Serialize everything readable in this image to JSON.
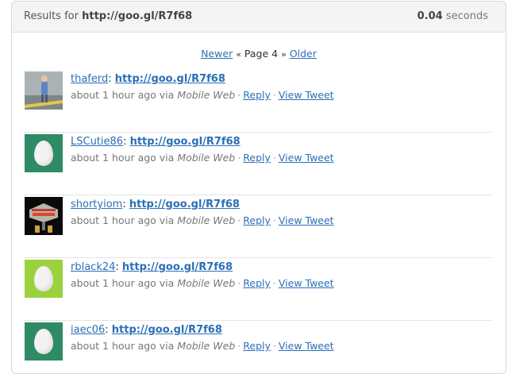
{
  "header": {
    "results_prefix": "Results for",
    "query": "http://goo.gl/R7f68",
    "time_value": "0.04",
    "time_unit": "seconds"
  },
  "pager": {
    "newer_label": "Newer",
    "page_label": "Page 4",
    "older_label": "Older",
    "left_sep": "«",
    "right_sep": "»"
  },
  "tweets": [
    {
      "user": "thaferd",
      "url": "http://goo.gl/R7f68",
      "time": "about 1 hour ago via",
      "source": "Mobile Web",
      "reply": "Reply",
      "view": "View Tweet",
      "avatar": "photo-avatar"
    },
    {
      "user": "LSCutie86",
      "url": "http://goo.gl/R7f68",
      "time": "about 1 hour ago via",
      "source": "Mobile Web",
      "reply": "Reply",
      "view": "View Tweet",
      "avatar": "egg-avatar"
    },
    {
      "user": "shortyiom",
      "url": "http://goo.gl/R7f68",
      "time": "about 1 hour ago via",
      "source": "Mobile Web",
      "reply": "Reply",
      "view": "View Tweet",
      "avatar": "las-vegas-avatar"
    },
    {
      "user": "rblack24",
      "url": "http://goo.gl/R7f68",
      "time": "about 1 hour ago via",
      "source": "Mobile Web",
      "reply": "Reply",
      "view": "View Tweet",
      "avatar": "egg-avatar"
    },
    {
      "user": "iaec06",
      "url": "http://goo.gl/R7f68",
      "time": "about 1 hour ago via",
      "source": "Mobile Web",
      "reply": "Reply",
      "view": "View Tweet",
      "avatar": "egg-avatar"
    }
  ],
  "colors": {
    "link": "#2b6fb6",
    "egg_dark_bg": "#2f8a66",
    "egg_lime_bg": "#9ad23c",
    "header_bg": "#f4f4f4"
  }
}
